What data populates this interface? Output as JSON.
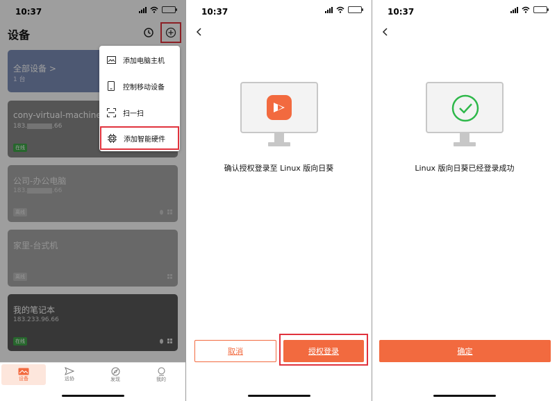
{
  "status": {
    "time": "10:37"
  },
  "devices_page": {
    "title": "设备",
    "all_devices_card": {
      "label": "全部设备 >",
      "count": "1 台"
    },
    "devices": [
      {
        "name": "cony-virtual-machine",
        "ip_prefix": "183.",
        "ip_suffix": ".66",
        "status": "在线"
      },
      {
        "name": "公司-办公电脑",
        "ip_prefix": "183.",
        "ip_suffix": ".66",
        "status": "离线"
      },
      {
        "name": "家里-台式机",
        "ip_prefix": "",
        "ip_suffix": "",
        "status": "离线"
      },
      {
        "name": "我的笔记本",
        "ip_prefix": "183.233.96.66",
        "ip_suffix": "",
        "status": "在线"
      }
    ],
    "menu": [
      {
        "label": "添加电脑主机",
        "icon": "image-icon"
      },
      {
        "label": "控制移动设备",
        "icon": "phone-icon"
      },
      {
        "label": "扫一扫",
        "icon": "scan-icon"
      },
      {
        "label": "添加智能硬件",
        "icon": "chip-icon"
      }
    ],
    "tabs": [
      {
        "label": "设备",
        "icon": "devices-icon",
        "active": true
      },
      {
        "label": "远协",
        "icon": "send-icon",
        "active": false
      },
      {
        "label": "发现",
        "icon": "compass-icon",
        "active": false
      },
      {
        "label": "我的",
        "icon": "profile-icon",
        "active": false
      }
    ]
  },
  "confirm_page": {
    "message": "确认授权登录至 Linux 版向日葵",
    "cancel_label": "取消",
    "authorize_label": "授权登录"
  },
  "success_page": {
    "message": "Linux 版向日葵已经登录成功",
    "ok_label": "确定"
  },
  "colors": {
    "accent": "#f26a3f",
    "highlight": "#e0323c",
    "success": "#2eb84a"
  }
}
